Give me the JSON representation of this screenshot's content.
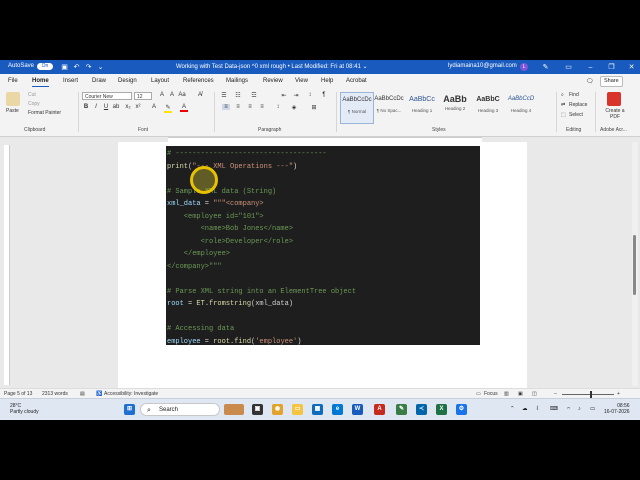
{
  "titlebar": {
    "autosave": "AutoSave",
    "autosave_state": "On",
    "doc_title": "Working with Test Data-json ^0 xml rough • Last Modified: Fri at 08:41 ⌄",
    "user_email": "lydiamaina10@gmail.com",
    "avatar_letter": "L"
  },
  "tabs": [
    "File",
    "Home",
    "Insert",
    "Draw",
    "Design",
    "Layout",
    "References",
    "Mailings",
    "Review",
    "View",
    "Help",
    "Acrobat"
  ],
  "share_label": "Share",
  "ribbon": {
    "clipboard": {
      "paste": "Paste",
      "cut": "Cut",
      "copy": "Copy",
      "format_painter": "Format Painter",
      "label": "Clipboard"
    },
    "font": {
      "family": "Courier New",
      "size": "12",
      "label": "Font"
    },
    "paragraph": {
      "label": "Paragraph"
    },
    "styles": {
      "items": [
        {
          "sample": "AaBbCcDc",
          "name": "¶ Normal"
        },
        {
          "sample": "AaBbCcDc",
          "name": "¶ No Spac..."
        },
        {
          "sample": "AaBbCc",
          "name": "Heading 1"
        },
        {
          "sample": "AaBb",
          "name": "Heading 2"
        },
        {
          "sample": "AaBbC",
          "name": "Heading 3"
        },
        {
          "sample": "AaBbCcD",
          "name": "Heading 4"
        }
      ],
      "label": "Styles"
    },
    "editing": {
      "find": "Find",
      "replace": "Replace",
      "select": "Select",
      "label": "Editing"
    },
    "adobe": {
      "create_pdf": "Create a PDF",
      "label": "Adobe Acr..."
    }
  },
  "code_lines": [
    {
      "parts": [
        {
          "t": "# ------------------------------------",
          "c": "cmt"
        }
      ]
    },
    {
      "parts": [
        {
          "t": "print",
          "c": "kw"
        },
        {
          "t": "(",
          "c": ""
        },
        {
          "t": "\"--- XML Operations ---\"",
          "c": "str"
        },
        {
          "t": ")",
          "c": ""
        }
      ]
    },
    {
      "parts": [
        {
          "t": "",
          "c": ""
        }
      ]
    },
    {
      "parts": [
        {
          "t": "# Sample XML data (String)",
          "c": "cmt"
        }
      ]
    },
    {
      "parts": [
        {
          "t": "xml_data",
          "c": "var"
        },
        {
          "t": " = ",
          "c": ""
        },
        {
          "t": "\"\"\"<company>",
          "c": "str"
        }
      ]
    },
    {
      "parts": [
        {
          "t": "    <employee id=\"101\">",
          "c": "green"
        }
      ]
    },
    {
      "parts": [
        {
          "t": "        <name>Bob Jones</name>",
          "c": "green"
        }
      ]
    },
    {
      "parts": [
        {
          "t": "        <role>Developer</role>",
          "c": "green"
        }
      ]
    },
    {
      "parts": [
        {
          "t": "    </employee>",
          "c": "green"
        }
      ]
    },
    {
      "parts": [
        {
          "t": "</company>\"\"\"",
          "c": "green"
        }
      ]
    },
    {
      "parts": [
        {
          "t": "",
          "c": ""
        }
      ]
    },
    {
      "parts": [
        {
          "t": "# Parse XML string into an ElementTree object",
          "c": "cmt"
        }
      ]
    },
    {
      "parts": [
        {
          "t": "root",
          "c": "var"
        },
        {
          "t": " = ",
          "c": ""
        },
        {
          "t": "ET.fromstring",
          "c": "kw"
        },
        {
          "t": "(xml_data)",
          "c": ""
        }
      ]
    },
    {
      "parts": [
        {
          "t": "",
          "c": ""
        }
      ]
    },
    {
      "parts": [
        {
          "t": "# Accessing data",
          "c": "cmt"
        }
      ]
    },
    {
      "parts": [
        {
          "t": "employee",
          "c": "var"
        },
        {
          "t": " = ",
          "c": ""
        },
        {
          "t": "root.find",
          "c": "kw"
        },
        {
          "t": "(",
          "c": ""
        },
        {
          "t": "'employee'",
          "c": "str"
        },
        {
          "t": ")",
          "c": ""
        }
      ]
    }
  ],
  "status": {
    "page": "Page 5 of 13",
    "words": "2313 words",
    "accessibility": "Accessibility: Investigate",
    "focus": "Focus"
  },
  "taskbar": {
    "temp": "28°C",
    "weather": "Partly cloudy",
    "search": "Search",
    "time": "08:56",
    "date": "16-07-2026"
  },
  "colors": {
    "word_blue": "#185abd",
    "code_bg": "#1e1e1e"
  }
}
